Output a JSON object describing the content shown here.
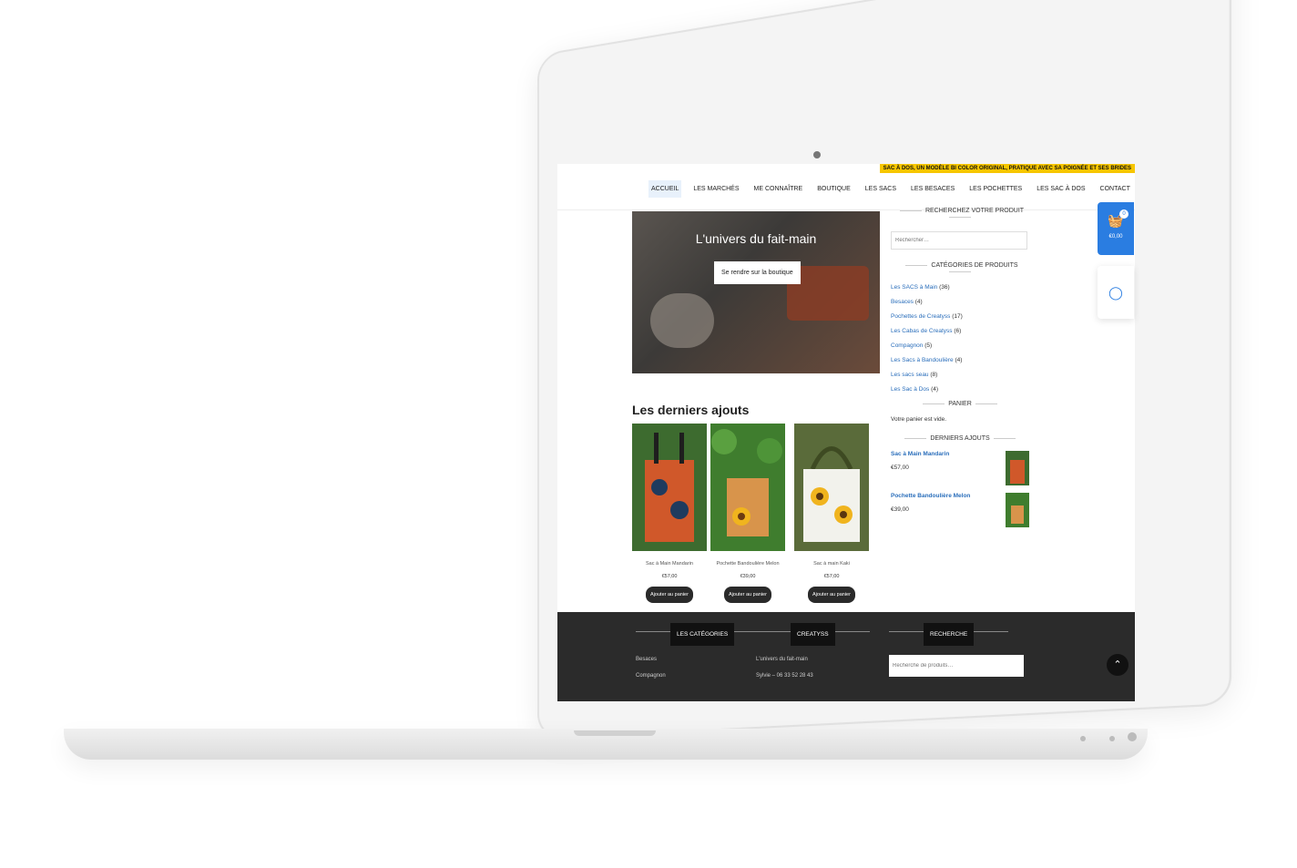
{
  "promo_text": "SAC À DOS, UN MODÈLE BI COLOR ORIGINAL, PRATIQUE AVEC SA POIGNÉE ET SES BRIDES",
  "nav": [
    "ACCUEIL",
    "LES MARCHÉS",
    "ME CONNAÎTRE",
    "BOUTIQUE",
    "LES SACS",
    "LES BESACES",
    "LES POCHETTES",
    "LES SAC À DOS",
    "CONTACT"
  ],
  "hero": {
    "title": "L'univers du fait-main",
    "button": "Se rendre sur la boutique"
  },
  "latest": {
    "title": "Les derniers ajouts",
    "products": [
      {
        "name": "Sac à Main Mandarin",
        "price": "€57,00",
        "button": "Ajouter au panier"
      },
      {
        "name": "Pochette Bandoulière Melon",
        "price": "€39,00",
        "button": "Ajouter au panier"
      },
      {
        "name": "Sac à main Kaki",
        "price": "€57,00",
        "button": "Ajouter au panier"
      }
    ]
  },
  "sidebar": {
    "search_heading": "RECHERCHEZ VOTRE PRODUIT",
    "search_placeholder": "Rechercher…",
    "categories_heading": "CATÉGORIES DE PRODUITS",
    "categories": [
      {
        "name": "Les SACS à Main",
        "count": "(36)"
      },
      {
        "name": "Besaces",
        "count": "(4)"
      },
      {
        "name": "Pochettes de Creatyss",
        "count": "(17)"
      },
      {
        "name": "Les Cabas de Creatyss",
        "count": "(6)"
      },
      {
        "name": "Compagnon",
        "count": "(5)"
      },
      {
        "name": "Les Sacs à Bandoulière",
        "count": "(4)"
      },
      {
        "name": "Les sacs seau",
        "count": "(8)"
      },
      {
        "name": "Les Sac à Dos",
        "count": "(4)"
      }
    ],
    "cart_heading": "PANIER",
    "cart_empty": "Votre panier est vide.",
    "recent_heading": "DERNIERS AJOUTS",
    "recent": [
      {
        "name": "Sac à Main Mandarin",
        "price": "€57,00"
      },
      {
        "name": "Pochette Bandoulière Melon",
        "price": "€39,00"
      }
    ]
  },
  "footer": {
    "col1_heading": "LES CATÉGORIES",
    "col1_items": [
      "Besaces",
      "Compagnon"
    ],
    "col2_heading": "CREATYSS",
    "col2_items": [
      "L'univers du fait-main",
      "Sylvie – 06 33 52 28 43"
    ],
    "col3_heading": "RECHERCHE",
    "col3_placeholder": "Recherche de produits…"
  },
  "cart_widget": {
    "count": "0",
    "total": "€0,00"
  }
}
